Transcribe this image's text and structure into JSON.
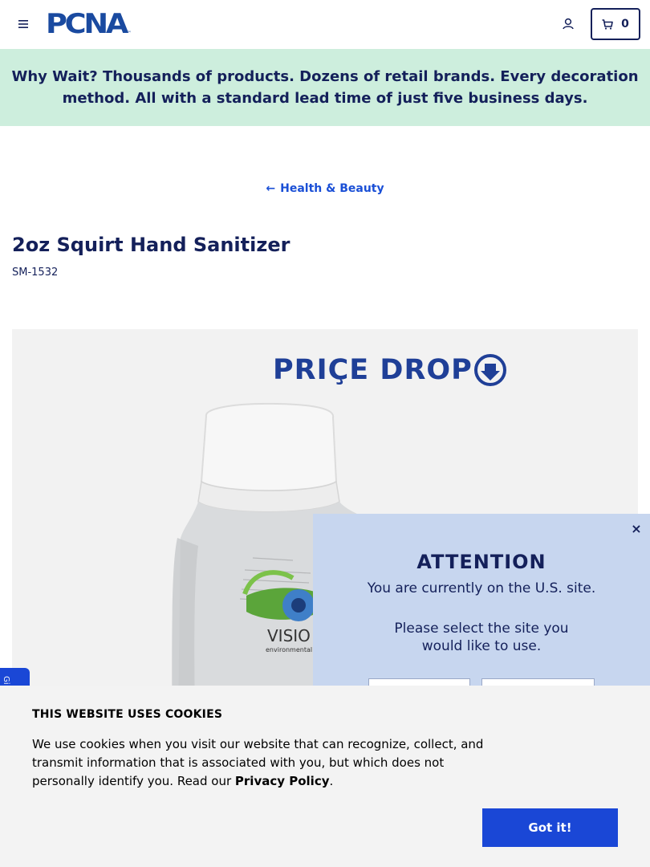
{
  "header": {
    "logo_text": "PCNA",
    "logo_tm": "™",
    "cart_count": "0"
  },
  "banner": {
    "text": "Why Wait? Thousands of products. Dozens of retail brands. Every decoration method. All with a standard lead time of just five business days."
  },
  "breadcrumb": {
    "arrow": "←",
    "label": "Health & Beauty"
  },
  "product": {
    "title": "2oz Squirt Hand Sanitizer",
    "sku": "SM-1532",
    "image_badge": "PRIÇE DROP",
    "image_label_brand": "VISIO",
    "image_label_sub": "environmental ma"
  },
  "attention": {
    "close": "×",
    "heading": "ATTENTION",
    "line1": "You are currently on the U.S. site.",
    "line2": "Please select the site you would like to use."
  },
  "side_tab": {
    "label": "Gi"
  },
  "cookie": {
    "title": "THIS WEBSITE USES COOKIES",
    "text": "We use cookies when you visit our website that can recognize, collect, and transmit information that is associated with you, but which does not personally identify you. Read our ",
    "link": "Privacy Policy",
    "period": ".",
    "button": "Got it!"
  },
  "colors": {
    "navy": "#14205a",
    "brand_blue": "#1a47d6",
    "banner_green": "#cdeedd",
    "modal_blue": "#c7d6ef"
  }
}
